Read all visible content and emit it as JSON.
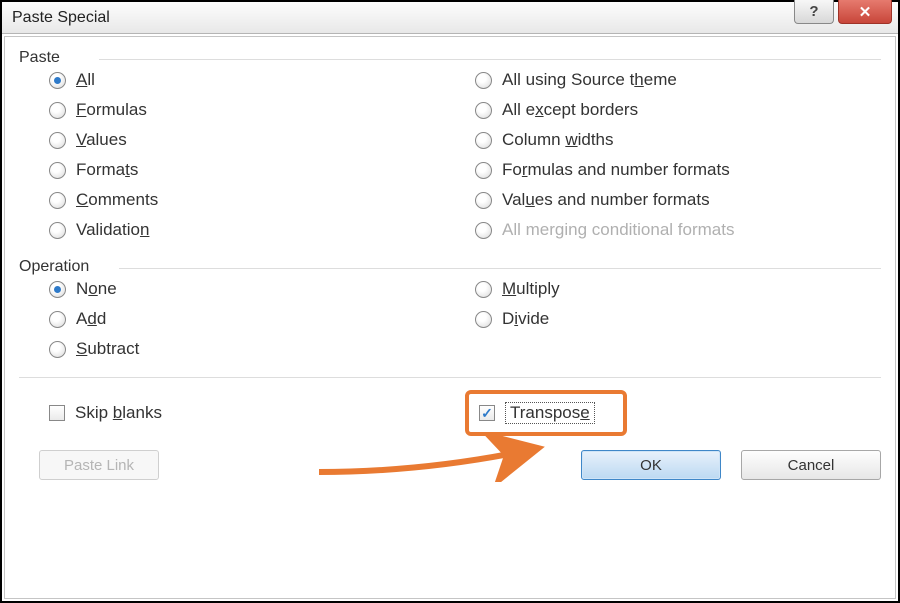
{
  "title": "Paste Special",
  "groups": {
    "paste": {
      "label": "Paste",
      "left": [
        {
          "key": "all",
          "pre": "",
          "u": "A",
          "post": "ll",
          "selected": true
        },
        {
          "key": "formulas",
          "pre": "",
          "u": "F",
          "post": "ormulas",
          "selected": false
        },
        {
          "key": "values",
          "pre": "",
          "u": "V",
          "post": "alues",
          "selected": false
        },
        {
          "key": "formats",
          "pre": "Forma",
          "u": "t",
          "post": "s",
          "selected": false
        },
        {
          "key": "comments",
          "pre": "",
          "u": "C",
          "post": "omments",
          "selected": false
        },
        {
          "key": "validation",
          "pre": "Validatio",
          "u": "n",
          "post": "",
          "selected": false
        }
      ],
      "right": [
        {
          "key": "all-source-theme",
          "pre": "All using Source t",
          "u": "h",
          "post": "eme",
          "selected": false,
          "disabled": false
        },
        {
          "key": "all-except-borders",
          "pre": "All e",
          "u": "x",
          "post": "cept borders",
          "selected": false,
          "disabled": false
        },
        {
          "key": "column-widths",
          "pre": "Column ",
          "u": "w",
          "post": "idths",
          "selected": false,
          "disabled": false
        },
        {
          "key": "formulas-number-formats",
          "pre": "Fo",
          "u": "r",
          "post": "mulas and number formats",
          "selected": false,
          "disabled": false
        },
        {
          "key": "values-number-formats",
          "pre": "Val",
          "u": "u",
          "post": "es and number formats",
          "selected": false,
          "disabled": false
        },
        {
          "key": "all-merging-conditional",
          "pre": "All mer",
          "u": "g",
          "post": "ing conditional formats",
          "selected": false,
          "disabled": true
        }
      ]
    },
    "operation": {
      "label": "Operation",
      "left": [
        {
          "key": "none",
          "pre": "N",
          "u": "o",
          "post": "ne",
          "selected": true
        },
        {
          "key": "add",
          "pre": "A",
          "u": "d",
          "post": "d",
          "selected": false
        },
        {
          "key": "subtract",
          "pre": "",
          "u": "S",
          "post": "ubtract",
          "selected": false
        }
      ],
      "right": [
        {
          "key": "multiply",
          "pre": "",
          "u": "M",
          "post": "ultiply",
          "selected": false
        },
        {
          "key": "divide",
          "pre": "D",
          "u": "i",
          "post": "vide",
          "selected": false
        }
      ]
    }
  },
  "checks": {
    "skip_blanks": {
      "pre": "Skip ",
      "u": "b",
      "post": "lanks",
      "checked": false
    },
    "transpose": {
      "pre": "Transpos",
      "u": "e",
      "post": "",
      "checked": true
    }
  },
  "buttons": {
    "paste_link": "Paste Link",
    "ok": "OK",
    "cancel": "Cancel"
  },
  "colors": {
    "highlight": "#e97a32",
    "accent": "#2e7ac9"
  }
}
